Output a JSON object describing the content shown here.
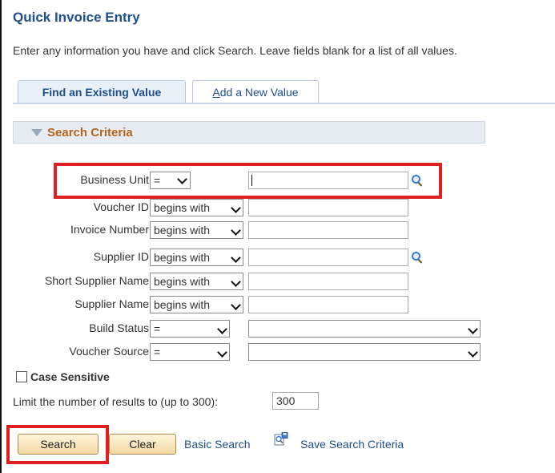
{
  "page": {
    "title": "Quick Invoice Entry",
    "instructions": "Enter any information you have and click Search. Leave fields blank for a list of all values."
  },
  "tabs": {
    "find": "Find an Existing Value",
    "add_first": "A",
    "add_rest": "dd a New Value"
  },
  "criteria": {
    "title": "Search Criteria"
  },
  "fields": {
    "business_unit": {
      "label": "Business Unit",
      "operator": "=",
      "value": ""
    },
    "voucher_id": {
      "label": "Voucher ID",
      "operator": "begins with",
      "value": ""
    },
    "invoice_number": {
      "label": "Invoice Number",
      "operator": "begins with",
      "value": ""
    },
    "supplier_id": {
      "label": "Supplier ID",
      "operator": "begins with",
      "value": ""
    },
    "short_supplier_name": {
      "label": "Short Supplier Name",
      "operator": "begins with",
      "value": ""
    },
    "supplier_name": {
      "label": "Supplier Name",
      "operator": "begins with",
      "value": ""
    },
    "build_status": {
      "label": "Build Status",
      "operator": "=",
      "value": ""
    },
    "voucher_source": {
      "label": "Voucher Source",
      "operator": "=",
      "value": ""
    }
  },
  "case_sensitive": {
    "label": "Case Sensitive",
    "checked": false
  },
  "limit": {
    "label": "Limit the number of results to (up to 300):",
    "value": "300"
  },
  "actions": {
    "search": "Search",
    "clear": "Clear",
    "basic_search": "Basic Search",
    "save_criteria": "Save Search Criteria"
  },
  "colors": {
    "title": "#1f4e8c",
    "criteria_title": "#b5651d",
    "highlight": "#e02020",
    "button_bg": "#f3d9a3"
  },
  "icons": [
    "lookup-icon",
    "save-search-icon",
    "collapse-triangle-icon",
    "chevron-down-icon"
  ]
}
